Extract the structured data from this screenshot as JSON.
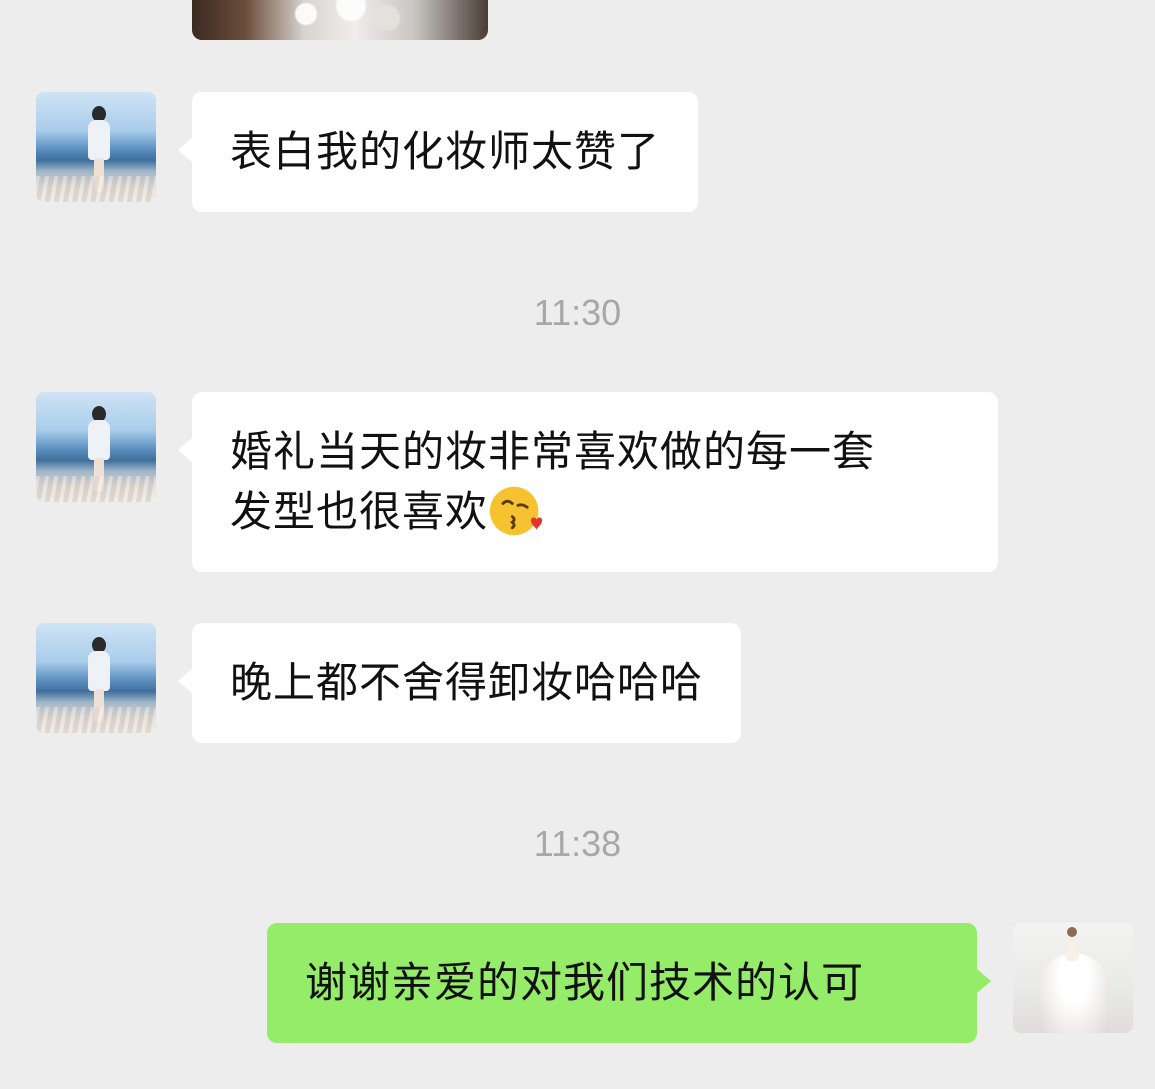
{
  "messages": [
    {
      "sender": "other",
      "text": "表白我的化妆师太赞了"
    },
    {
      "type": "timestamp",
      "text": "11:30"
    },
    {
      "sender": "other",
      "line1": "婚礼当天的妆非常喜欢做的每一套",
      "line2": "发型也很喜欢",
      "emoji": "kiss-heart-emoji"
    },
    {
      "sender": "other",
      "text": "晚上都不舍得卸妆哈哈哈"
    },
    {
      "type": "timestamp",
      "text": "11:38"
    },
    {
      "sender": "self",
      "text": "谢谢亲爱的对我们技术的认可"
    }
  ],
  "colors": {
    "background": "#ededed",
    "incoming_bubble": "#ffffff",
    "outgoing_bubble": "#95ec69",
    "timestamp": "#a7a7a7"
  }
}
